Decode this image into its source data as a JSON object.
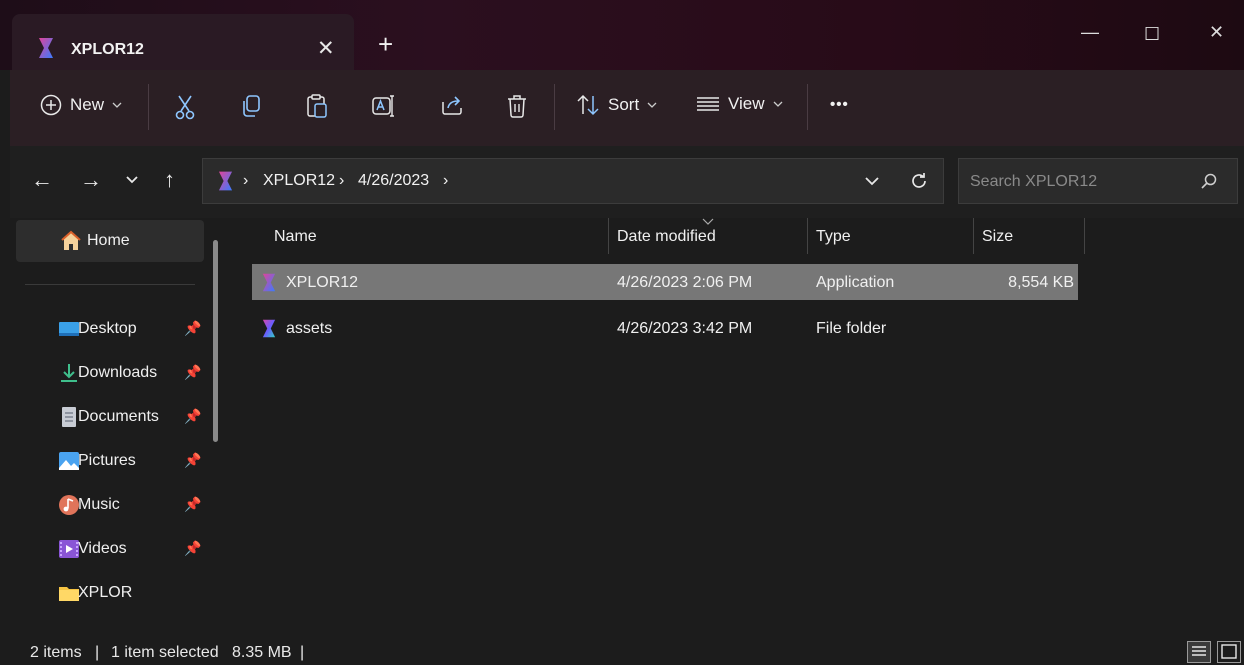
{
  "window": {
    "tab_title": "XPLOR12",
    "tab_close_glyph": "✕",
    "new_tab_glyph": "+",
    "minimize_glyph": "—",
    "maximize_glyph": "☐",
    "close_glyph": "✕"
  },
  "toolbar": {
    "new_label": "New",
    "sort_label": "Sort",
    "view_label": "View",
    "more_glyph": "•••",
    "icons": [
      "add-icon",
      "cut-icon",
      "copy-icon",
      "paste-icon",
      "rename-icon",
      "share-icon",
      "delete-icon",
      "sort-icon",
      "view-icon",
      "more-icon"
    ]
  },
  "nav": {
    "back_glyph": "←",
    "forward_glyph": "→",
    "recent_glyph": "⌄",
    "up_glyph": "↑",
    "breadcrumbs": [
      "XPLOR12",
      "4/26/2023"
    ],
    "crumb_sep": "›",
    "dropdown_glyph": "⌄",
    "refresh_glyph": "⟳"
  },
  "search": {
    "placeholder": "Search XPLOR12",
    "value": ""
  },
  "sidebar": {
    "home_label": "Home",
    "items": [
      {
        "label": "Desktop",
        "icon": "desktop-icon",
        "pinned": true
      },
      {
        "label": "Downloads",
        "icon": "download-icon",
        "pinned": true
      },
      {
        "label": "Documents",
        "icon": "documents-icon",
        "pinned": true
      },
      {
        "label": "Pictures",
        "icon": "pictures-icon",
        "pinned": true
      },
      {
        "label": "Music",
        "icon": "music-icon",
        "pinned": true
      },
      {
        "label": "Videos",
        "icon": "videos-icon",
        "pinned": true
      },
      {
        "label": "XPLOR",
        "icon": "folder-icon",
        "pinned": false
      }
    ]
  },
  "columns": {
    "name": "Name",
    "date": "Date modified",
    "type": "Type",
    "size": "Size"
  },
  "files": [
    {
      "name": "XPLOR12",
      "date": "4/26/2023 2:06 PM",
      "type": "Application",
      "size": "8,554 KB",
      "selected": true
    },
    {
      "name": "assets",
      "date": "4/26/2023 3:42 PM",
      "type": "File folder",
      "size": "",
      "selected": false
    }
  ],
  "status": {
    "items": "2 items",
    "selected": "1 item selected",
    "size": "8.35 MB",
    "sep": "|"
  },
  "colors": {
    "accent_pink": "#e0449a",
    "accent_blue": "#3a7bff",
    "selection": "#777777"
  }
}
